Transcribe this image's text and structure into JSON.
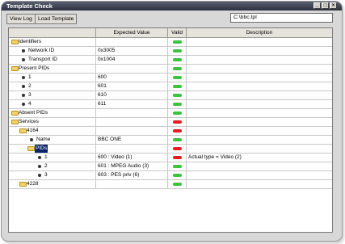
{
  "window": {
    "title": "Template Check"
  },
  "toolbar": {
    "view_log": "View Log",
    "load_template": "Load Template",
    "path": "C:\\bbc.tpl"
  },
  "columns": {
    "name": "",
    "expected": "Expected Value",
    "valid": "Valid",
    "description": "Description"
  },
  "colors": {
    "valid": "#3cc23c",
    "invalid": "#e02020",
    "folder": "#f2d36b",
    "selection": "#0a246a"
  },
  "rows": [
    {
      "label": "Identifiers",
      "kind": "folder",
      "level": 0,
      "value": "",
      "valid": "green",
      "description": ""
    },
    {
      "label": "Network ID",
      "kind": "leaf",
      "level": 1,
      "value": "0x3005",
      "valid": "green",
      "description": ""
    },
    {
      "label": "Transport ID",
      "kind": "leaf",
      "level": 1,
      "value": "0x1004",
      "valid": "green",
      "description": ""
    },
    {
      "label": "Present PIDs",
      "kind": "folder",
      "level": 0,
      "value": "",
      "valid": "green",
      "description": ""
    },
    {
      "label": "1",
      "kind": "leaf",
      "level": 1,
      "value": "600",
      "valid": "green",
      "description": ""
    },
    {
      "label": "2",
      "kind": "leaf",
      "level": 1,
      "value": "601",
      "valid": "green",
      "description": ""
    },
    {
      "label": "3",
      "kind": "leaf",
      "level": 1,
      "value": "610",
      "valid": "green",
      "description": ""
    },
    {
      "label": "4",
      "kind": "leaf",
      "level": 1,
      "value": "611",
      "valid": "green",
      "description": ""
    },
    {
      "label": "Absent PIDs",
      "kind": "folder",
      "level": 0,
      "value": "",
      "valid": "green",
      "description": ""
    },
    {
      "label": "Services",
      "kind": "folder",
      "level": 0,
      "value": "",
      "valid": "red",
      "description": ""
    },
    {
      "label": "4164",
      "kind": "folder",
      "level": 1,
      "value": "",
      "valid": "red",
      "description": ""
    },
    {
      "label": "Name",
      "kind": "leaf",
      "level": 2,
      "value": "BBC ONE",
      "valid": "green",
      "description": ""
    },
    {
      "label": "PIDs",
      "kind": "folder",
      "level": 2,
      "value": "",
      "valid": "red",
      "description": "",
      "selected": true
    },
    {
      "label": "1",
      "kind": "leaf",
      "level": 3,
      "value": "600 : Video (1)",
      "valid": "red",
      "description": "Actual type = Video (2)"
    },
    {
      "label": "2",
      "kind": "leaf",
      "level": 3,
      "value": "601 : MPEG Audio (3)",
      "valid": "green",
      "description": ""
    },
    {
      "label": "3",
      "kind": "leaf",
      "level": 3,
      "value": "603 : PES priv (6)",
      "valid": "green",
      "description": ""
    },
    {
      "label": "4228",
      "kind": "folder",
      "level": 1,
      "value": "",
      "valid": "green",
      "description": ""
    }
  ]
}
